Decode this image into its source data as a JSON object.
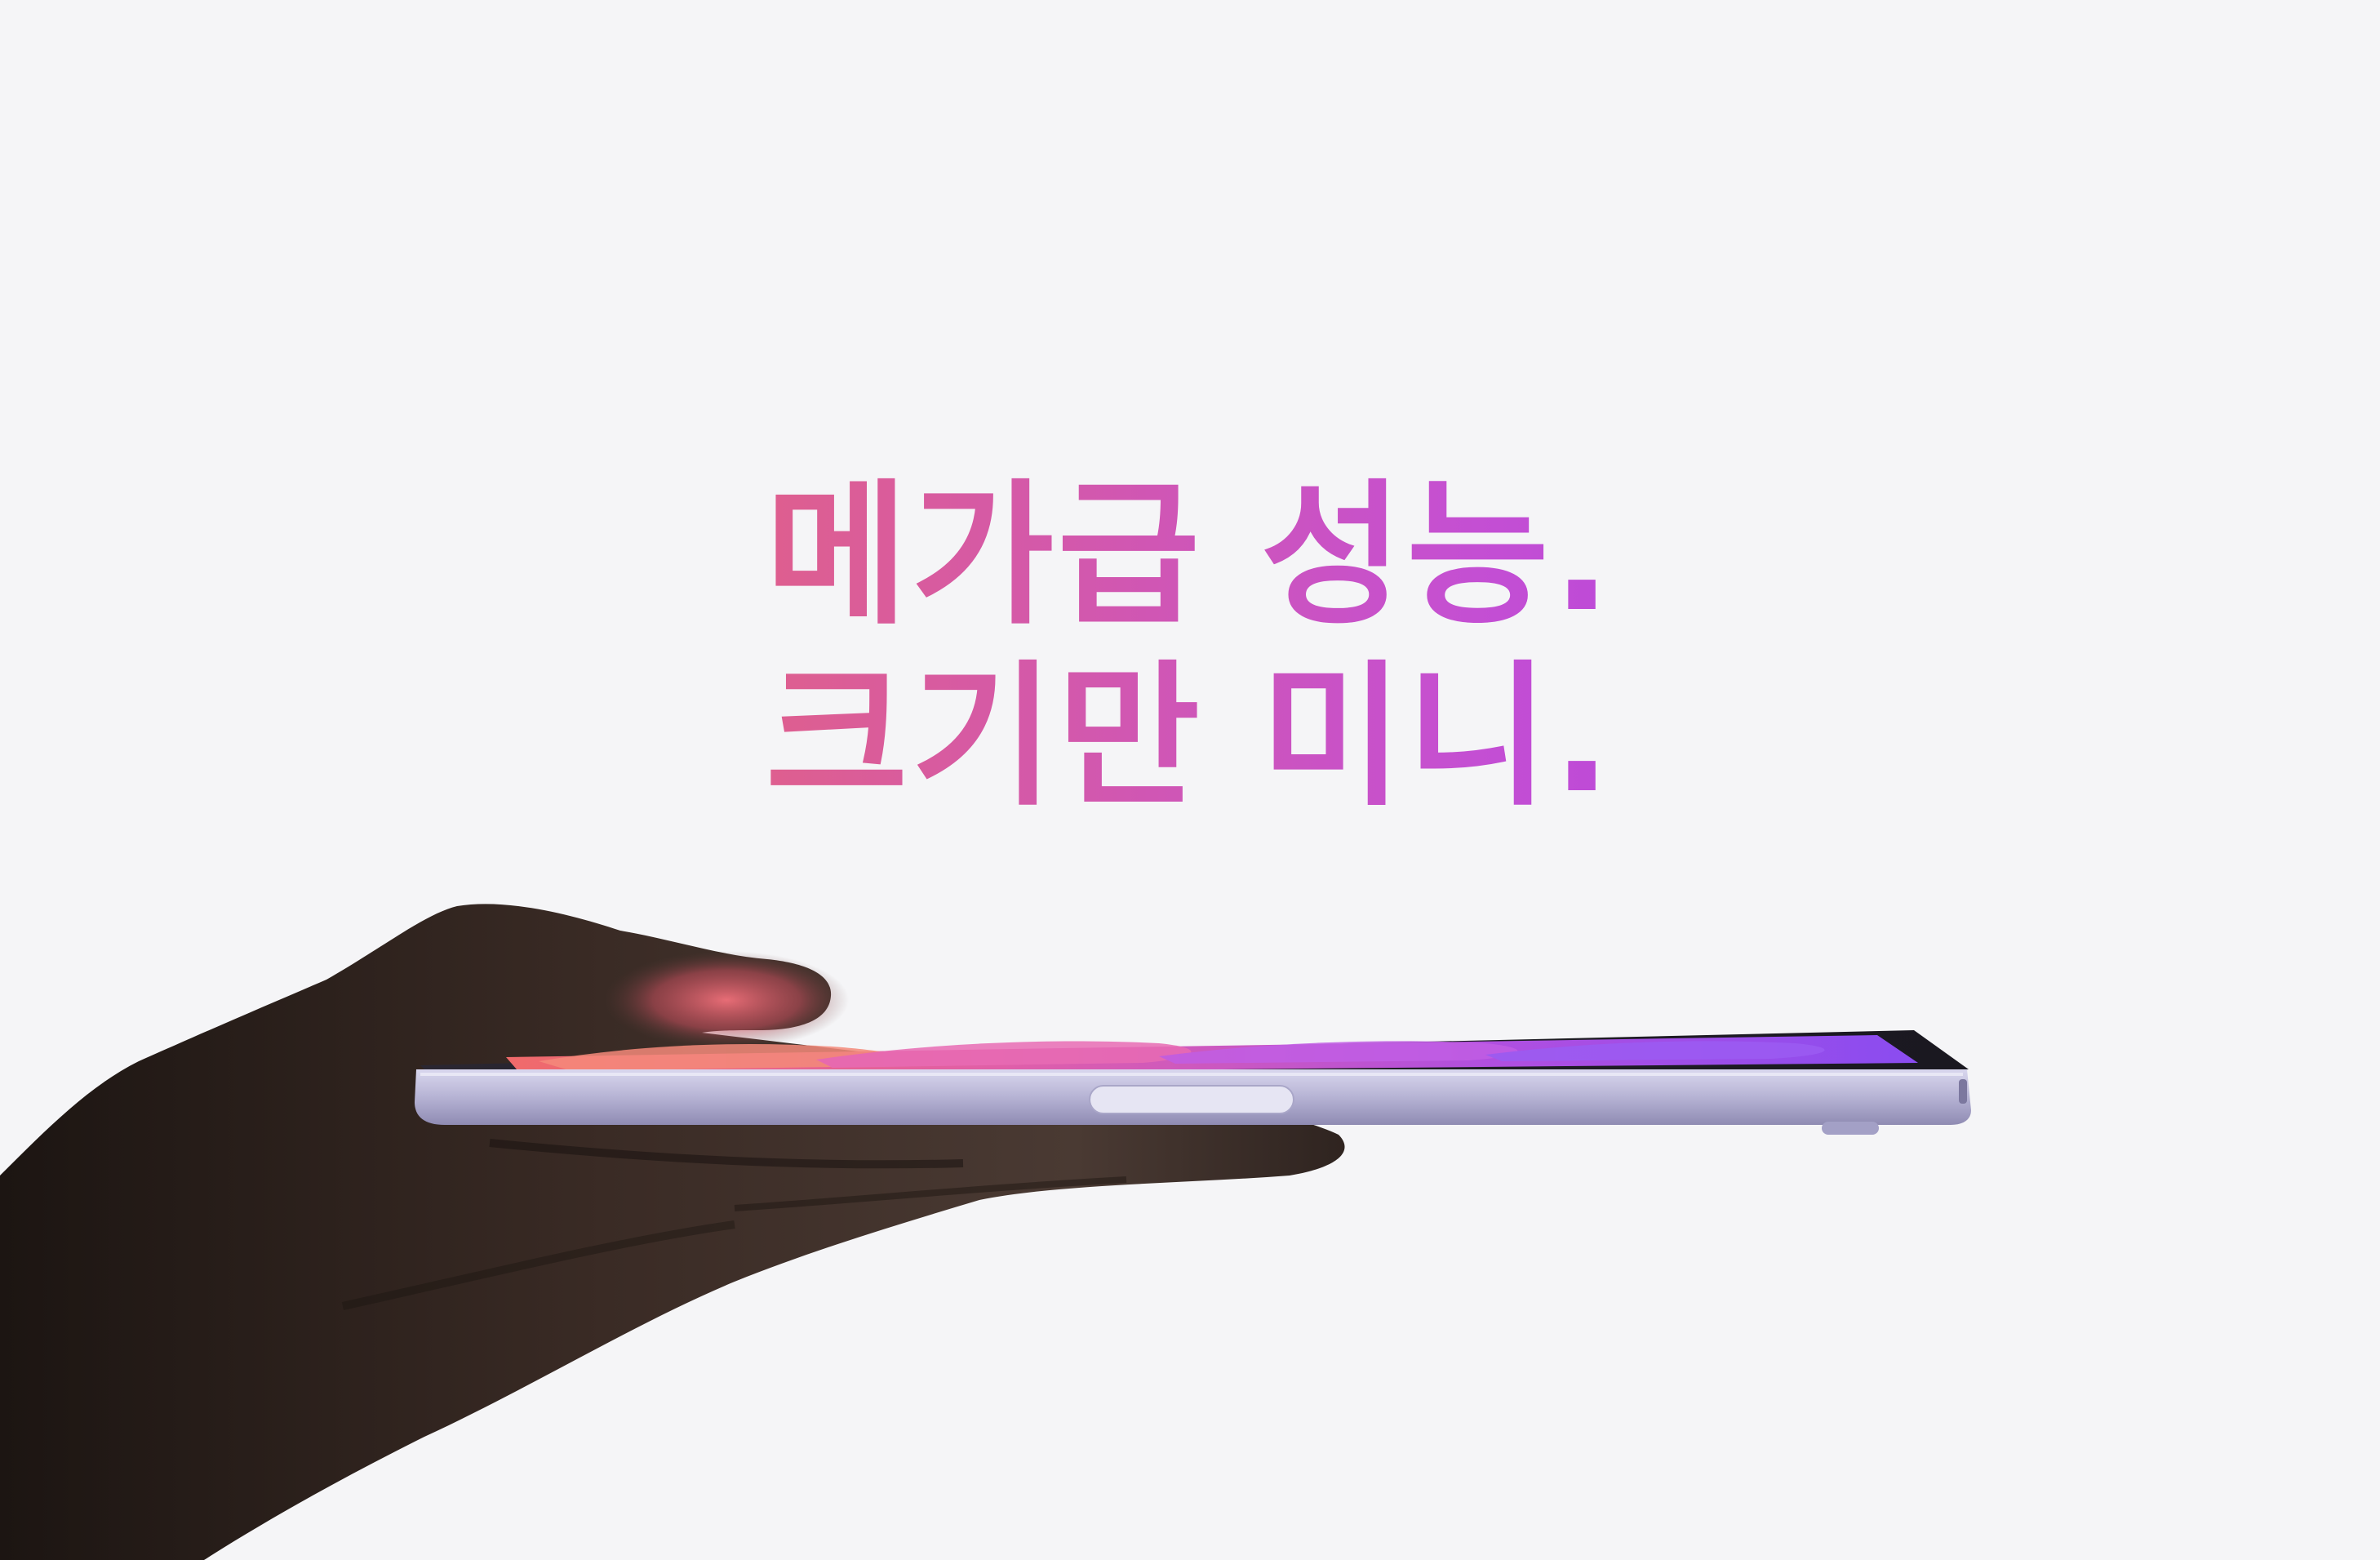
{
  "headline": {
    "line1": "메가급 성능.",
    "line2": "크기만 미니."
  },
  "colors": {
    "background": "#f5f5f7",
    "gradient_start": "#ee6f6d",
    "gradient_mid": "#c44fd3",
    "gradient_end": "#9a2ef0",
    "device_frame": "#b9b7d6",
    "skin_shadow": "#2a211d"
  },
  "image": {
    "subject": "hand-holding-tablet-icon"
  }
}
